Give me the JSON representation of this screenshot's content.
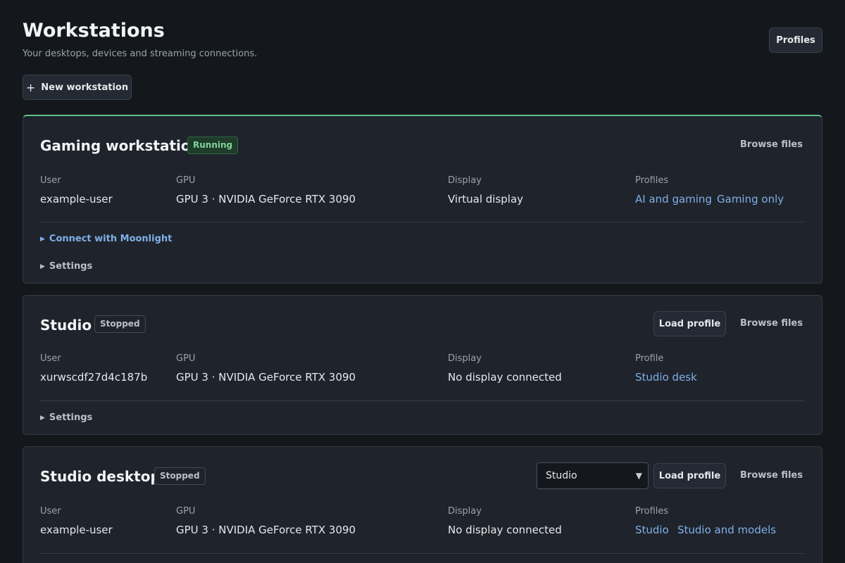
{
  "header": {
    "title": "Workstations",
    "subtitle": "Your desktops, devices and streaming connections.",
    "profiles_button": "Profiles",
    "new_button": "New workstation",
    "new_button_icon": "plus-icon"
  },
  "cards": [
    {
      "name": "Gaming workstation",
      "status": "Running",
      "browse": "Browse files",
      "user_label": "User",
      "user": "example-user",
      "gpu_label": "GPU",
      "gpu": "GPU 3 · NVIDIA GeForce RTX 3090",
      "display_label": "Display",
      "display": "Virtual display",
      "profiles_label": "Profiles",
      "profiles": [
        "AI and gaming",
        "Gaming only"
      ],
      "connect": "Connect with Moonlight",
      "settings": "Settings"
    },
    {
      "name": "Studio",
      "status": "Stopped",
      "load": "Load profile",
      "browse": "Browse files",
      "user_label": "User",
      "user": "xurwscdf27d4c187b",
      "gpu_label": "GPU",
      "gpu": "GPU 3 · NVIDIA GeForce RTX 3090",
      "display_label": "Display",
      "display": "No display connected",
      "profiles_label": "Profile",
      "profiles": [
        "Studio desk"
      ],
      "settings": "Settings"
    },
    {
      "name": "Studio desktop",
      "status": "Stopped",
      "select_value": "Studio",
      "load": "Load profile",
      "browse": "Browse files",
      "user_label": "User",
      "user": "example-user",
      "gpu_label": "GPU",
      "gpu": "GPU 3 · NVIDIA GeForce RTX 3090",
      "display_label": "Display",
      "display": "No display connected",
      "profiles_label": "Profiles",
      "profiles": [
        "Studio",
        "Studio and models"
      ]
    }
  ],
  "colors": {
    "background": "#14171c",
    "card": "#1f232b",
    "accent_link": "#7fb0e8",
    "running": "#5fbf86"
  }
}
